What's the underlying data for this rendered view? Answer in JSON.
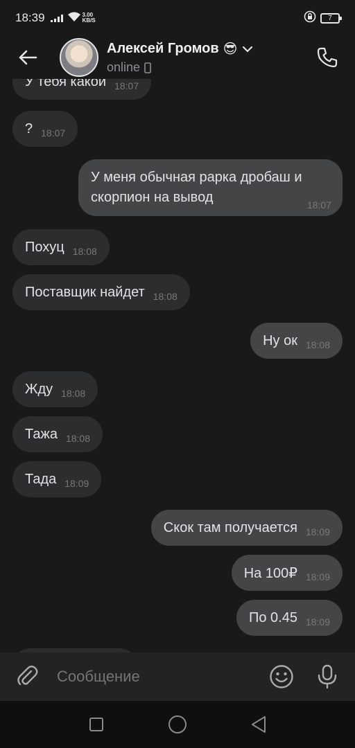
{
  "status_bar": {
    "time": "18:39",
    "speed_value": "3.00",
    "speed_unit": "KB/S",
    "battery": "7"
  },
  "header": {
    "contact_name": "Алексей Громов",
    "contact_emoji": "😎",
    "contact_status": "online"
  },
  "messages": [
    {
      "text": "У тебя какой",
      "time": "18:07",
      "dir": "in"
    },
    {
      "text": "?",
      "time": "18:07",
      "dir": "in"
    },
    {
      "text": "У меня обычная рарка дробаш и скорпион на вывод",
      "time": "18:07",
      "dir": "out"
    },
    {
      "text": "Похуц",
      "time": "18:08",
      "dir": "in"
    },
    {
      "text": "Поставщик найдет",
      "time": "18:08",
      "dir": "in"
    },
    {
      "text": "Ну ок",
      "time": "18:08",
      "dir": "out"
    },
    {
      "text": "Жду",
      "time": "18:08",
      "dir": "in"
    },
    {
      "text": "Тажа",
      "time": "18:08",
      "dir": "in"
    },
    {
      "text": "Тада",
      "time": "18:09",
      "dir": "in"
    },
    {
      "text": "Скок там получается",
      "time": "18:09",
      "dir": "out"
    },
    {
      "text": "На 100₽",
      "time": "18:09",
      "dir": "out"
    },
    {
      "text": "По 0.45",
      "time": "18:09",
      "dir": "out"
    }
  ],
  "input": {
    "placeholder": "Сообщение"
  },
  "icons": {
    "back": "arrow-left-icon",
    "call": "phone-icon",
    "attach": "paperclip-icon",
    "emoji": "smiley-icon",
    "mic": "microphone-icon",
    "device": "smartphone-icon",
    "dropdown": "chevron-down-icon"
  }
}
